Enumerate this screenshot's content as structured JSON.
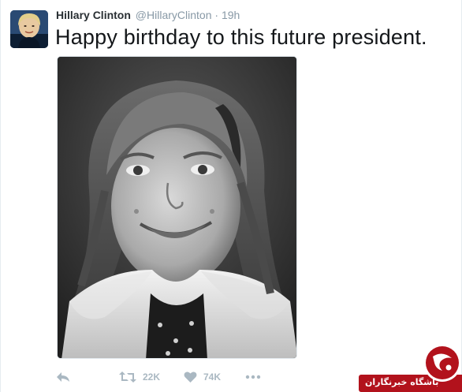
{
  "tweet": {
    "author_name": "Hillary Clinton",
    "handle": "@HillaryClinton",
    "separator": "·",
    "time": "19h",
    "text": "Happy birthday to this future president."
  },
  "actions": {
    "reply_icon": "reply-icon",
    "retweet_icon": "retweet-icon",
    "retweet_count": "22K",
    "like_icon": "heart-icon",
    "like_count": "74K",
    "more_icon": "more-dots-icon"
  },
  "watermark": {
    "text": "باشگاه خبرنگاران",
    "color": "#b2121c"
  },
  "colors": {
    "name": "#292f33",
    "muted": "#8899a6",
    "action": "#aab8c2",
    "text": "#14171a"
  }
}
